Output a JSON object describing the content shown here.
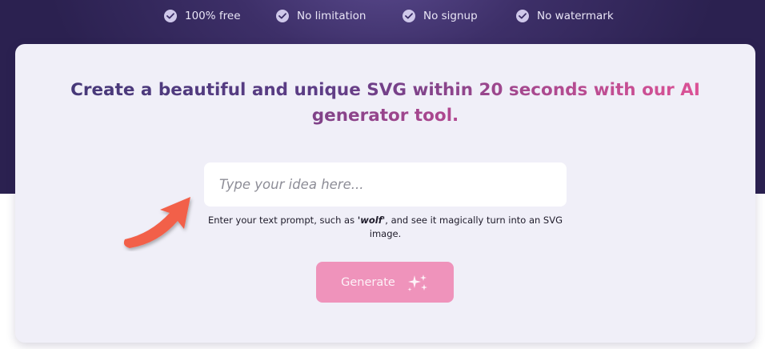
{
  "features": [
    {
      "label": "100% free"
    },
    {
      "label": "No limitation"
    },
    {
      "label": "No signup"
    },
    {
      "label": "No watermark"
    }
  ],
  "hero": {
    "headline_line1": "Create a beautiful and unique SVG within 20 seconds with our AI",
    "headline_line2": "generator tool."
  },
  "prompt": {
    "placeholder": "Type your idea here...",
    "value": "",
    "hint_before": "Enter your text prompt, such as ",
    "hint_example": "'wolf'",
    "hint_after": ", and see it magically turn into an SVG image."
  },
  "generate": {
    "label": "Generate"
  },
  "colors": {
    "hero_bg": "#2f2455",
    "card_bg": "#f0eff8",
    "button_bg": "#ef93bb",
    "arrow": "#f2614a",
    "headline_start": "#463878",
    "headline_end": "#dc5296"
  },
  "icons": [
    "check-icon",
    "sparkles-icon",
    "arrow-annotation"
  ]
}
